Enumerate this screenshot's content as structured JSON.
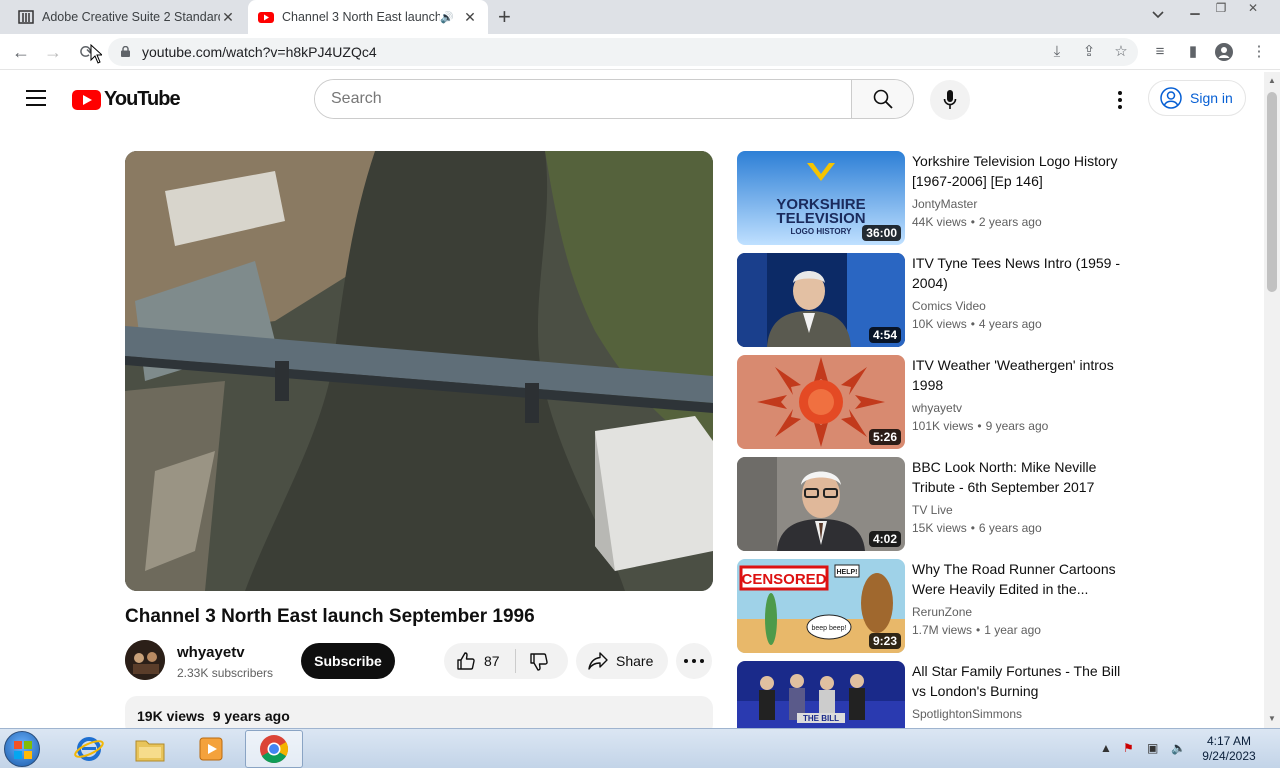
{
  "browser": {
    "tabs": [
      {
        "title": "Adobe Creative Suite 2 Standard",
        "favicon": "archive-icon"
      },
      {
        "title": "Channel 3 North East launch",
        "favicon": "youtube-icon",
        "audio": "speaker-icon"
      }
    ],
    "new_tab": "+",
    "tab_search": "⌄",
    "url": "youtube.com/watch?v=h8kPJ4UZQc4"
  },
  "youtube": {
    "logo_text": "YouTube",
    "search_placeholder": "Search",
    "sign_in": "Sign in"
  },
  "video": {
    "title": "Channel 3 North East launch September 1996",
    "channel": "whyayetv",
    "subscribers": "2.33K subscribers",
    "subscribe_label": "Subscribe",
    "likes": "87",
    "share_label": "Share",
    "views": "19K views",
    "age": "9 years ago"
  },
  "recommended": [
    {
      "title": "Yorkshire Television Logo History [1967-2006] [Ep 146]",
      "channel": "JontyMaster",
      "views": "44K views",
      "age": "2 years ago",
      "duration": "36:00",
      "thumb_text": [
        "YORKSHIRE",
        "TELEVISION",
        "LOGO HISTORY"
      ]
    },
    {
      "title": "ITV Tyne Tees News Intro (1959 - 2004)",
      "channel": "Comics Video",
      "views": "10K views",
      "age": "4 years ago",
      "duration": "4:54"
    },
    {
      "title": "ITV Weather 'Weathergen' intros 1998",
      "channel": "whyayetv",
      "views": "101K views",
      "age": "9 years ago",
      "duration": "5:26"
    },
    {
      "title": "BBC Look North: Mike Neville Tribute - 6th September 2017",
      "channel": "TV Live",
      "views": "15K views",
      "age": "6 years ago",
      "duration": "4:02"
    },
    {
      "title": "Why The Road Runner Cartoons Were Heavily Edited in the...",
      "channel": "RerunZone",
      "views": "1.7M views",
      "age": "1 year ago",
      "duration": "9:23",
      "thumb_text": [
        "CENSORED",
        "HELP!",
        "beep beep!"
      ]
    },
    {
      "title": "All Star Family Fortunes - The Bill vs London's Burning",
      "channel": "SpotlightonSimmons",
      "views": "",
      "age": "",
      "duration": "",
      "thumb_text": [
        "THE BILL"
      ]
    }
  ],
  "taskbar": {
    "time": "4:17 AM",
    "date": "9/24/2023"
  }
}
